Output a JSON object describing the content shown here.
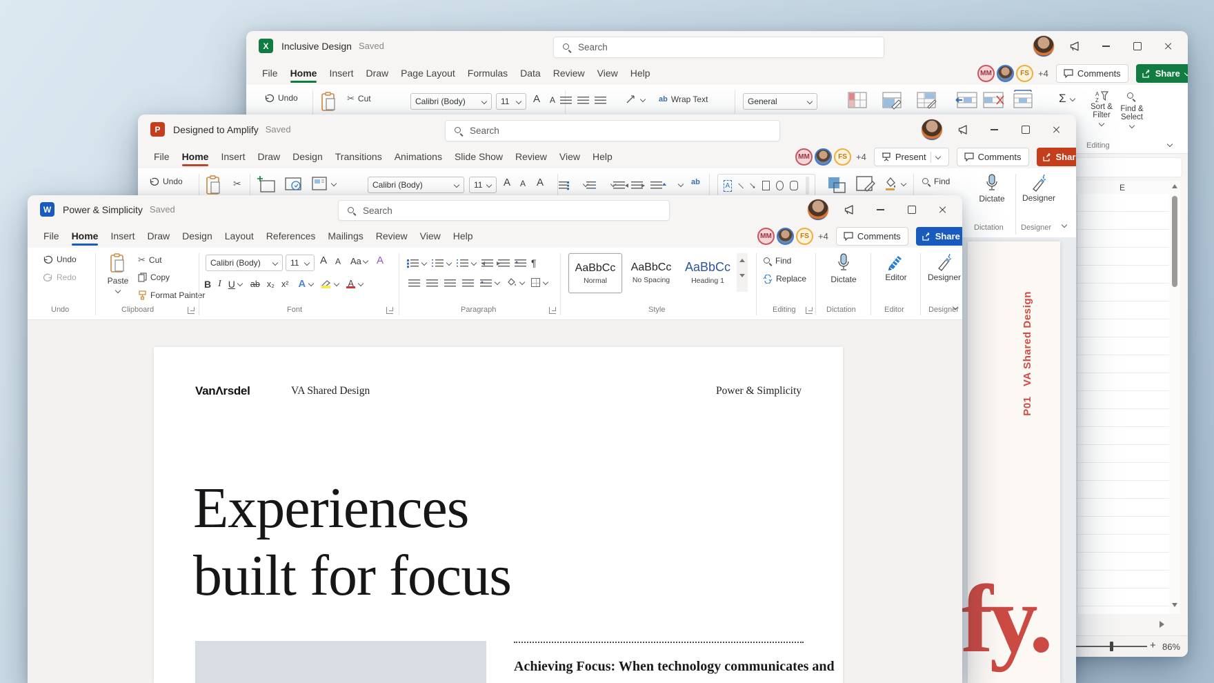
{
  "icons": {
    "excel_logo": "X",
    "ppt_logo": "P",
    "word_logo": "W",
    "scissors": "✂",
    "sigma": "Σ",
    "pilcrow": "¶",
    "letter_a": "A",
    "letter_aa": "Aa",
    "bold": "B",
    "italic": "I",
    "underline": "U",
    "strike_ab": "ab",
    "subscript": "x₂",
    "superscript": "x²",
    "sort_a": "A",
    "sort_z": "Z",
    "wrap_ab": "ab",
    "plus_zoom": "+"
  },
  "excel": {
    "title": "Inclusive Design",
    "saved": "Saved",
    "search_placeholder": "Search",
    "tabs": {
      "items": [
        "File",
        "Home",
        "Insert",
        "Draw",
        "Page Layout",
        "Formulas",
        "Data",
        "Review",
        "View",
        "Help"
      ],
      "active": "Home"
    },
    "accent": "#107c41",
    "avatars": {
      "a1": "MM",
      "a3": "FS",
      "overflow": "+4"
    },
    "comments_label": "Comments",
    "share_label": "Share",
    "ribbon": {
      "undo": "Undo",
      "cut": "Cut",
      "font_name": "Calibri (Body)",
      "font_size": "11",
      "wrap_text": "Wrap Text",
      "number_format": "General",
      "sort_filter_1": "Sort &",
      "sort_filter_2": "Filter",
      "find_select_1": "Find &",
      "find_select_2": "Select",
      "editing_group": "Editing"
    },
    "sheet": {
      "column_header": "E"
    },
    "status": {
      "zoom_level": "86%"
    }
  },
  "powerpoint": {
    "title": "Designed to Amplify",
    "saved": "Saved",
    "search_placeholder": "Search",
    "tabs": {
      "items": [
        "File",
        "Home",
        "Insert",
        "Draw",
        "Design",
        "Transitions",
        "Animations",
        "Slide Show",
        "Review",
        "View",
        "Help"
      ],
      "active": "Home"
    },
    "accent": "#b7472a",
    "avatars": {
      "a1": "MM",
      "a3": "FS",
      "overflow": "+4"
    },
    "present_label": "Present",
    "comments_label": "Comments",
    "share_label": "Share",
    "ribbon": {
      "undo": "Undo",
      "font_name": "Calibri (Body)",
      "font_size": "11",
      "find": "Find",
      "dictate": "Dictate",
      "dictation_group": "Dictation",
      "designer": "Designer",
      "designer_group": "Designer"
    },
    "slide": {
      "vertical_text": "P01   VA Shared Design",
      "display_text": "fy."
    }
  },
  "word": {
    "title": "Power & Simplicity",
    "saved": "Saved",
    "search_placeholder": "Search",
    "tabs": {
      "items": [
        "File",
        "Home",
        "Insert",
        "Draw",
        "Design",
        "Layout",
        "References",
        "Mailings",
        "Review",
        "View",
        "Help"
      ],
      "active": "Home"
    },
    "accent": "#185abd",
    "avatars": {
      "a1": "MM",
      "a3": "FS",
      "overflow": "+4"
    },
    "comments_label": "Comments",
    "share_label": "Share",
    "ribbon": {
      "undo": "Undo",
      "redo": "Redo",
      "undo_group": "Undo",
      "paste": "Paste",
      "cut": "Cut",
      "copy": "Copy",
      "format_painter": "Format Painter",
      "clipboard_group": "Clipboard",
      "font_name": "Calibri (Body)",
      "font_size": "11",
      "font_group": "Font",
      "paragraph_group": "Paragraph",
      "styles": [
        {
          "sample": "AaBbCc",
          "name": "Normal"
        },
        {
          "sample": "AaBbCc",
          "name": "No Spacing"
        },
        {
          "sample": "AaBbCc",
          "name": "Heading 1"
        }
      ],
      "style_group": "Style",
      "find": "Find",
      "replace": "Replace",
      "editing_group": "Editing",
      "dictate": "Dictate",
      "dictation_group": "Dictation",
      "editor": "Editor",
      "editor_group": "Editor",
      "designer": "Designer",
      "designer_group": "Designer"
    },
    "document": {
      "logo": "VanΛrsdel",
      "header_center": "VA Shared Design",
      "header_right": "Power & Simplicity",
      "heading_line1": "Experiences",
      "heading_line2": "built for focus",
      "body_lead": "Achieving Focus: When technology communicates and"
    }
  }
}
